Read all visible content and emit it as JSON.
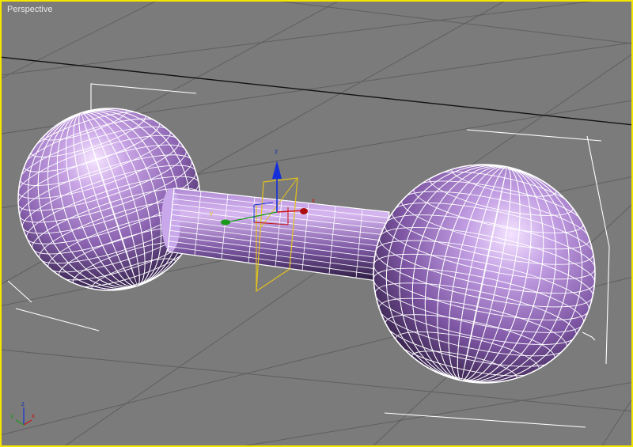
{
  "viewport": {
    "label": "Perspective",
    "active_border_color": "#f5e600",
    "background_color": "#7b7b7b",
    "grid_color": "#5a5a5a",
    "grid_center_line_color": "#111111"
  },
  "object": {
    "type": "dumbbell",
    "parts": [
      "sphere",
      "cylinder",
      "sphere"
    ],
    "display": "smooth + wireframe edged faces",
    "color": "#b792dc",
    "selected": true
  },
  "gizmo": {
    "labels": {
      "x": "x",
      "y": "y",
      "z": "z"
    },
    "colors": {
      "x": "#cc1111",
      "y": "#1a9a1a",
      "z": "#1530d8",
      "plane": "#e3c21c"
    }
  },
  "axis_tripod": {
    "labels": {
      "x": "x",
      "y": "y",
      "z": "z"
    }
  }
}
